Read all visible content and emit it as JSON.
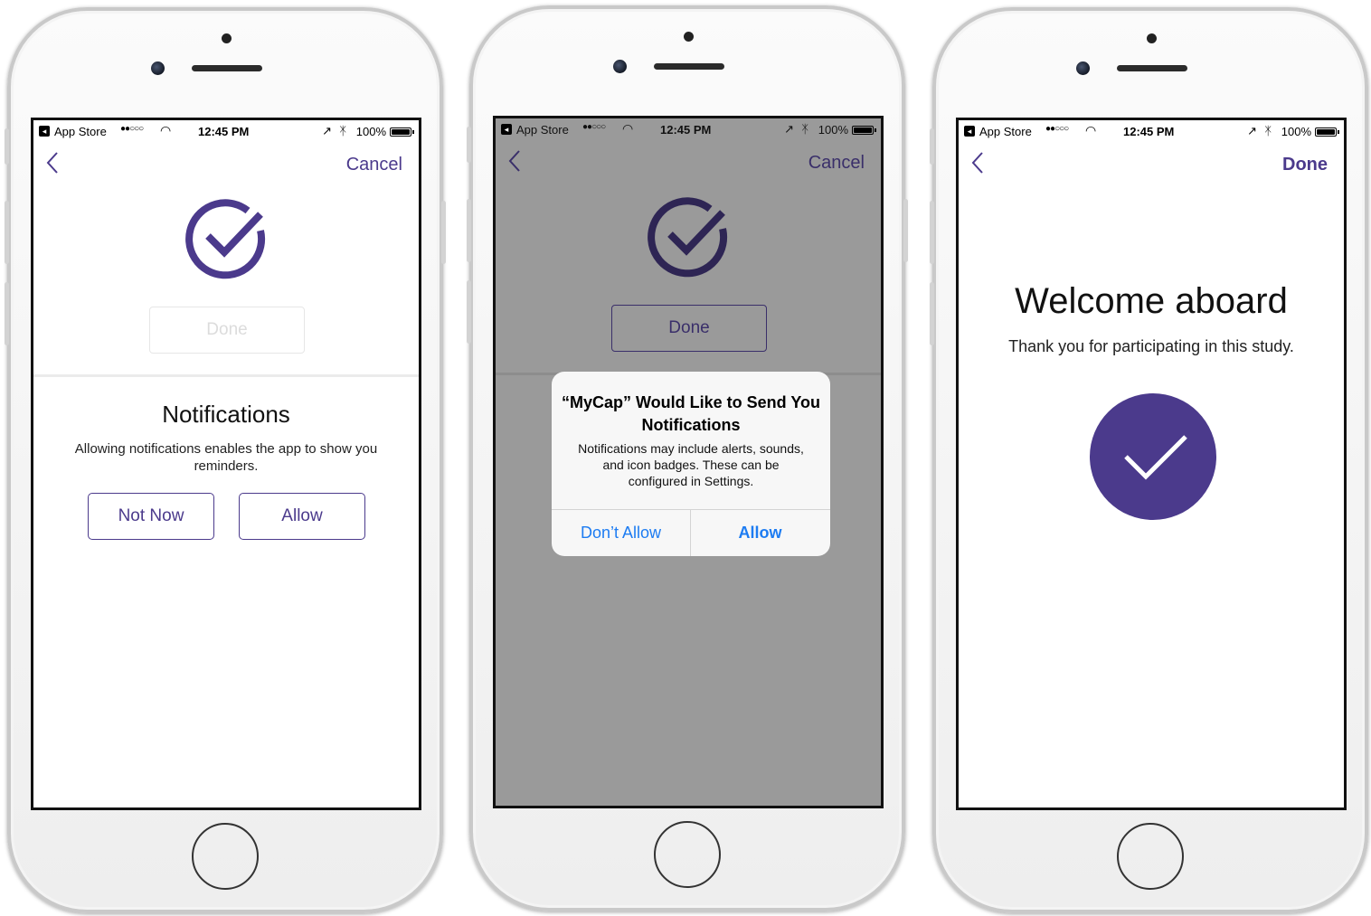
{
  "colors": {
    "accent": "#4b3a8c",
    "alert_blue": "#1d7cf2",
    "dim_overlay": "#9a9a9a"
  },
  "status_bar": {
    "back_app": "App Store",
    "signal": "●●○○○",
    "time": "12:45 PM",
    "battery": "100%"
  },
  "screen1": {
    "nav_right": "Cancel",
    "done_label": "Done",
    "title": "Notifications",
    "body": "Allowing notifications enables the app to show you reminders.",
    "not_now": "Not Now",
    "allow": "Allow"
  },
  "screen2": {
    "nav_right": "Cancel",
    "done_label": "Done",
    "alert": {
      "title": "“MyCap” Would Like to Send You Notifications",
      "message": "Notifications may include alerts, sounds, and icon badges. These can be configured in Settings.",
      "dont_allow": "Don’t Allow",
      "allow": "Allow"
    }
  },
  "screen3": {
    "nav_right": "Done",
    "title": "Welcome aboard",
    "subtitle": "Thank you for participating in this study."
  }
}
